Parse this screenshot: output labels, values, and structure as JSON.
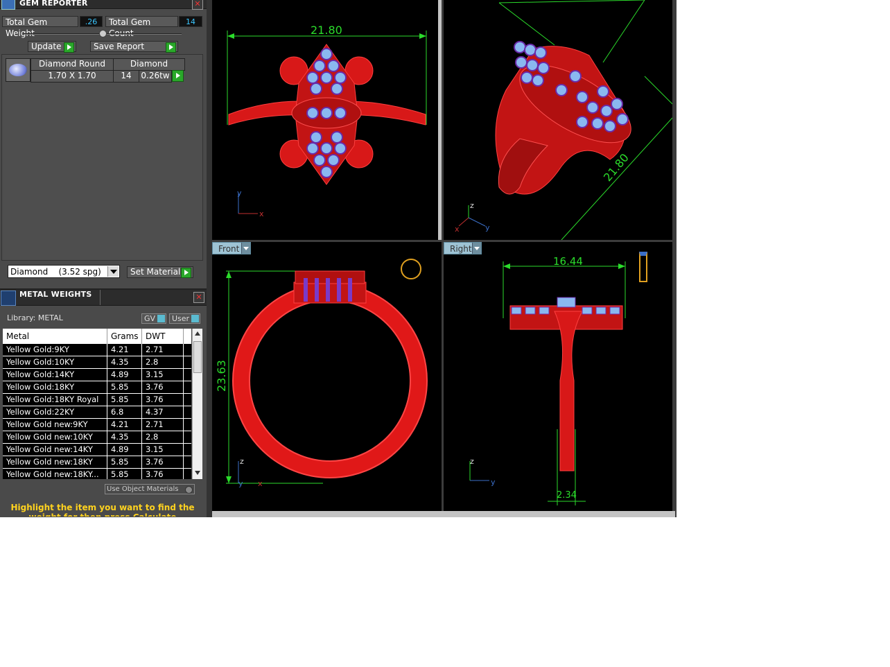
{
  "gem_reporter": {
    "title": "GEM REPORTER",
    "total_weight_label": "Total Gem Weight",
    "total_weight_value": ".26",
    "total_count_label": "Total Gem Count",
    "total_count_value": "14",
    "update_label": "Update",
    "save_report_label": "Save Report",
    "gem": {
      "name": "Diamond Round",
      "size": "1.70 X 1.70",
      "material": "Diamond",
      "count": "14",
      "weight": "0.26tw"
    },
    "material_select": "Diamond    (3.52 spg)",
    "set_material_label": "Set Material"
  },
  "metal_weights": {
    "title": "METAL WEIGHTS",
    "library_label": "Library: METAL",
    "gv_label": "GV",
    "user_label": "User",
    "columns": [
      "Metal",
      "Grams",
      "DWT"
    ],
    "rows": [
      [
        "Yellow Gold:9KY",
        "4.21",
        "2.71"
      ],
      [
        "Yellow Gold:10KY",
        "4.35",
        "2.8"
      ],
      [
        "Yellow Gold:14KY",
        "4.89",
        "3.15"
      ],
      [
        "Yellow Gold:18KY",
        "5.85",
        "3.76"
      ],
      [
        "Yellow Gold:18KY Royal",
        "5.85",
        "3.76"
      ],
      [
        "Yellow Gold:22KY",
        "6.8",
        "4.37"
      ],
      [
        "Yellow Gold new:9KY",
        "4.21",
        "2.71"
      ],
      [
        "Yellow Gold new:10KY",
        "4.35",
        "2.8"
      ],
      [
        "Yellow Gold new:14KY",
        "4.89",
        "3.15"
      ],
      [
        "Yellow Gold new:18KY",
        "5.85",
        "3.76"
      ],
      [
        "Yellow Gold new:18KY...",
        "5.85",
        "3.76"
      ]
    ],
    "use_object_materials": "Use Object Materials",
    "hint": "Highlight the item you want to find the weight for then press Calculate"
  },
  "viewports": {
    "top": {
      "dim": "21.80"
    },
    "perspective": {
      "dim": "21.80"
    },
    "front": {
      "label": "Front",
      "dim_v": "23.63"
    },
    "right": {
      "label": "Right",
      "dim_h": "16.44",
      "dim_b": "2.34"
    }
  },
  "colors": {
    "metal": "#e11b1b",
    "gem": "#8ab8f0",
    "prong": "#6a2aa8",
    "dimension": "#2bdc2b"
  }
}
